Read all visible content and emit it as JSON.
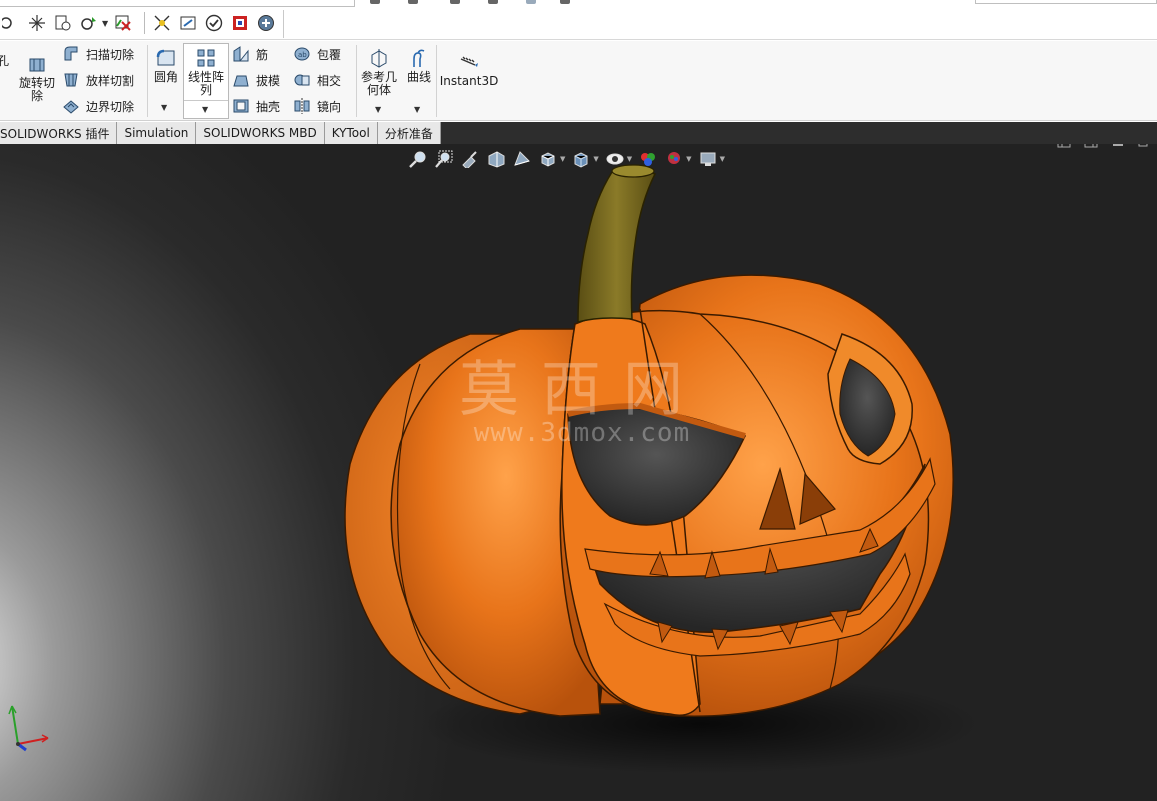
{
  "quick_toolbar": {
    "icons": [
      "hole-icon",
      "sketch-icon",
      "options-icon",
      "rebuild-icon",
      "select-icon",
      "exit-sketch-icon",
      "smart-dimension-icon",
      "relations-icon",
      "check-icon",
      "display-icon",
      "appearance-icon"
    ]
  },
  "ribbon": {
    "partial_left": "孔",
    "revolve_cut": "旋转切\n除",
    "sweep_cut": "扫描切除",
    "loft_cut": "放样切割",
    "boundary_cut": "边界切除",
    "fillet": "圆角",
    "linear_pattern": "线性阵\n列",
    "rib": "筋",
    "draft": "拔模",
    "shell": "抽壳",
    "wrap": "包覆",
    "intersect": "相交",
    "mirror": "镜向",
    "reference_geometry": "参考几\n何体",
    "curves": "曲线",
    "instant3d": "Instant3D"
  },
  "tabs": [
    {
      "label": "SOLIDWORKS 插件"
    },
    {
      "label": "Simulation"
    },
    {
      "label": "SOLIDWORKS MBD"
    },
    {
      "label": "KYTool"
    },
    {
      "label": "分析准备"
    }
  ],
  "watermark": {
    "title": "莫西网",
    "url": "www.3dmox.com"
  },
  "colors": {
    "pumpkin": "#e8741a",
    "pumpkin_dark": "#a8460a",
    "stem": "#7a6a1f",
    "background": "#2a2a2a"
  }
}
